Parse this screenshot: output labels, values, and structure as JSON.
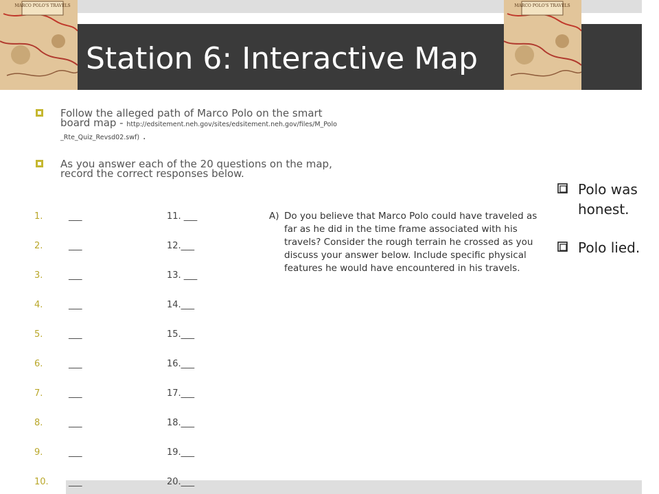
{
  "slide": {
    "title": "Station 6: Interactive Map",
    "bullets": [
      {
        "text": "Follow the alleged path of Marco Polo on the smart board map - ",
        "url": "http://edsitement.neh.gov/sites/edsitement.neh.gov/files/M_Polo_Rte_Quiz_Revsd02.swf)",
        "suffix": " ."
      },
      {
        "text": "As you answer each of the 20 questions on the map, record the correct responses below."
      }
    ],
    "answers_left": [
      {
        "num": "1.",
        "blank": "___"
      },
      {
        "num": "2.",
        "blank": "___"
      },
      {
        "num": "3.",
        "blank": "___"
      },
      {
        "num": "4.",
        "blank": "___"
      },
      {
        "num": "5.",
        "blank": "___"
      },
      {
        "num": "6.",
        "blank": "___"
      },
      {
        "num": "7.",
        "blank": "___"
      },
      {
        "num": "8.",
        "blank": "___"
      },
      {
        "num": "9.",
        "blank": "___"
      },
      {
        "num": "10.",
        "blank": "___"
      }
    ],
    "answers_right": [
      "11. ___",
      "12.___",
      "13. ___",
      "14.___",
      "15.___",
      "16.___",
      "17.___",
      "18.___",
      "19.___",
      "20.___"
    ],
    "question": {
      "label": "A)",
      "text": "Do you believe that Marco Polo could have traveled as far as he did in the time frame associated with his travels? Consider the rough terrain he crossed as you discuss your answer below. Include specific physical features he would have encountered in his travels."
    },
    "poll": [
      "Polo was honest.",
      "Polo lied."
    ],
    "map_image": {
      "label": "MARCO POLO'S TRAVELS"
    },
    "colors": {
      "title_bar": "#3a3a3a",
      "accent": "#b9a72a"
    }
  }
}
